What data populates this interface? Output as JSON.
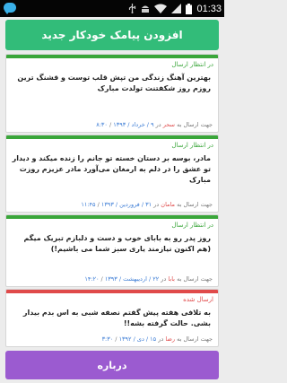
{
  "status_bar": {
    "time": "01:33"
  },
  "header": {
    "add_label": "افزودن پیامک خودکار جدید"
  },
  "messages": [
    {
      "status": "در انتظار ارسال",
      "status_color": "#3aa63a",
      "body": "بهترین آهنگ زندگی من تپش قلب توست و قشنگ ترین روزم روز شکفتنت تولدت مبارک",
      "meta_prefix": "جهت ارسال به",
      "recipient": "سحر",
      "meta_mid": "در",
      "date": "۹ / خرداد / ۱۳۹۳",
      "time": "۸:۳۰"
    },
    {
      "status": "در انتظار ارسال",
      "status_color": "#3aa63a",
      "body": "مادر، بوسه بر دستان خسته تو جانم را زنده میکند و دیدار تو عشق را در دلم به ارمغان می‌آورد مادر عزیزم روزت مبارک",
      "meta_prefix": "جهت ارسال به",
      "recipient": "مامان",
      "meta_mid": "در",
      "date": "۳۱ / فروردین / ۱۳۹۳",
      "time": "۱۱:۴۵"
    },
    {
      "status": "در انتظار ارسال",
      "status_color": "#3aa63a",
      "body": "روز پدر رو به بابای خوب و دست و دلبازم تبریک میگم (هم اکنون نیازمند یاری سبز شما می باشیم!)",
      "meta_prefix": "جهت ارسال به",
      "recipient": "بابا",
      "meta_mid": "در",
      "date": "۲۲ / اردیبهشت / ۱۳۹۳",
      "time": "۱۴:۲۰"
    },
    {
      "status": "ارسال شده",
      "status_color": "#e04a4a",
      "body": "به تلافی هفته پیش گفتم نصفه شبی به اس بدم بیدار بشی. حالت گرفته بشه!!",
      "meta_prefix": "جهت ارسال به",
      "recipient": "رضا",
      "meta_mid": "در",
      "date": "۱۵ / دی / ۱۳۹۲",
      "time": "۳:۳۰"
    }
  ],
  "footer": {
    "about_label": "درباره"
  }
}
